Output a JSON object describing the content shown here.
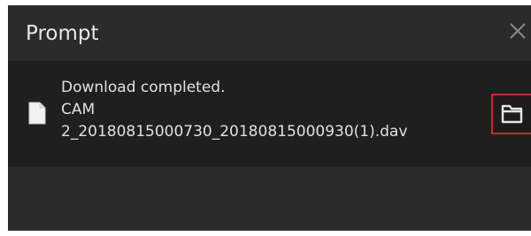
{
  "dialog": {
    "title": "Prompt",
    "close_icon": "close-icon"
  },
  "notification": {
    "status": "Download completed.",
    "file_line_1": "CAM",
    "file_line_2": "2_20180815000730_20180815000930(1).dav",
    "file_icon": "file-icon",
    "open_folder_icon": "folder-icon"
  },
  "colors": {
    "title_bg": "#2b2b2b",
    "content_bg": "#1f1f1f",
    "text": "#e0e0e0",
    "highlight": "#d8232a"
  }
}
